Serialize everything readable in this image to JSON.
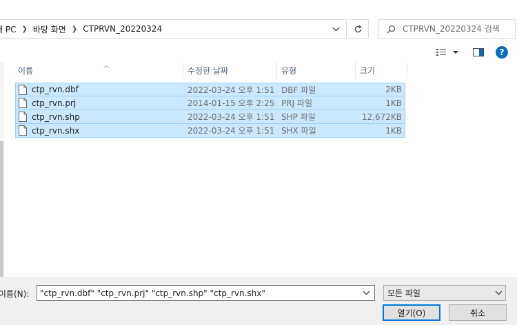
{
  "address": {
    "crumbs": [
      "내 PC",
      "바탕 화면",
      "CTPRVN_20220324"
    ]
  },
  "search": {
    "placeholder": "CTPRVN_20220324 검색"
  },
  "toolbar": {
    "help_label": "?"
  },
  "file_list": {
    "columns": [
      "이름",
      "수정한 날짜",
      "유형",
      "크기"
    ],
    "rows": [
      {
        "name": "ctp_rvn.dbf",
        "date": "2022-03-24 오후 1:51",
        "type": "DBF 파일",
        "size": "2KB"
      },
      {
        "name": "ctp_rvn.prj",
        "date": "2014-01-15 오후 2:25",
        "type": "PRJ 파일",
        "size": "1KB"
      },
      {
        "name": "ctp_rvn.shp",
        "date": "2022-03-24 오후 1:51",
        "type": "SHP 파일",
        "size": "12,672KB"
      },
      {
        "name": "ctp_rvn.shx",
        "date": "2022-03-24 오후 1:51",
        "type": "SHX 파일",
        "size": "1KB"
      }
    ]
  },
  "bottom": {
    "filename_label": "파일 이름(N):",
    "filename_value": "\"ctp_rvn.dbf\" \"ctp_rvn.prj\" \"ctp_rvn.shp\" \"ctp_rvn.shx\"",
    "filetype_value": "모든 파일",
    "open_label": "열기(O)",
    "cancel_label": "취소"
  },
  "colors": {
    "selection": "#cce8ff",
    "selection_border": "#99d1ff",
    "accent": "#0078d7"
  },
  "icons": [
    "chevron-right-icon",
    "chevron-down-icon",
    "refresh-icon",
    "search-icon",
    "view-toggle-icon",
    "preview-pane-icon",
    "help-icon",
    "file-icon",
    "sort-up-icon"
  ]
}
